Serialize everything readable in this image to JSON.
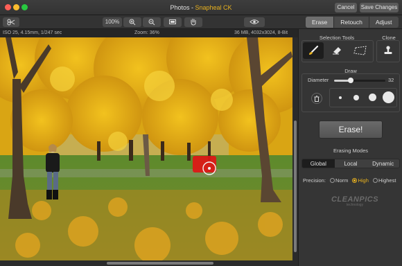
{
  "window": {
    "app_name": "Photos",
    "separator": " - ",
    "plugin_name": "Snapheal CK",
    "cancel_label": "Cancel",
    "save_label": "Save Changes",
    "traffic_colors": {
      "close": "#fd5f57",
      "minimize": "#fcbc2e",
      "zoom": "#28c840"
    }
  },
  "toolbar": {
    "zoom_value": "100%",
    "tabs": [
      {
        "label": "Erase",
        "active": true
      },
      {
        "label": "Retouch",
        "active": false
      },
      {
        "label": "Adjust",
        "active": false
      }
    ]
  },
  "info": {
    "camera": "ISO 25, 4.15mm, 1/247 sec",
    "zoom": "Zoom: 36%",
    "file": "36 MB, 4032x3024, 8-Bit"
  },
  "panel": {
    "selection_tools_label": "Selection Tools",
    "clone_label": "Clone",
    "draw_label": "Draw",
    "diameter_label": "Diameter",
    "diameter_value": "32",
    "diameter_fraction": 0.32,
    "erase_label": "Erase!",
    "erasing_modes_label": "Erasing Modes",
    "modes": [
      {
        "label": "Global",
        "active": true
      },
      {
        "label": "Local",
        "active": false
      },
      {
        "label": "Dynamic",
        "active": false
      }
    ],
    "precision_label": "Precision:",
    "precision_options": [
      {
        "label": "Norm",
        "selected": false
      },
      {
        "label": "High",
        "selected": true
      },
      {
        "label": "Highest",
        "selected": false
      }
    ],
    "watermark_text": "CLEANPICS",
    "watermark_sub": "technology"
  },
  "colors": {
    "accent": "#e9b21f",
    "mask": "#e01616"
  }
}
